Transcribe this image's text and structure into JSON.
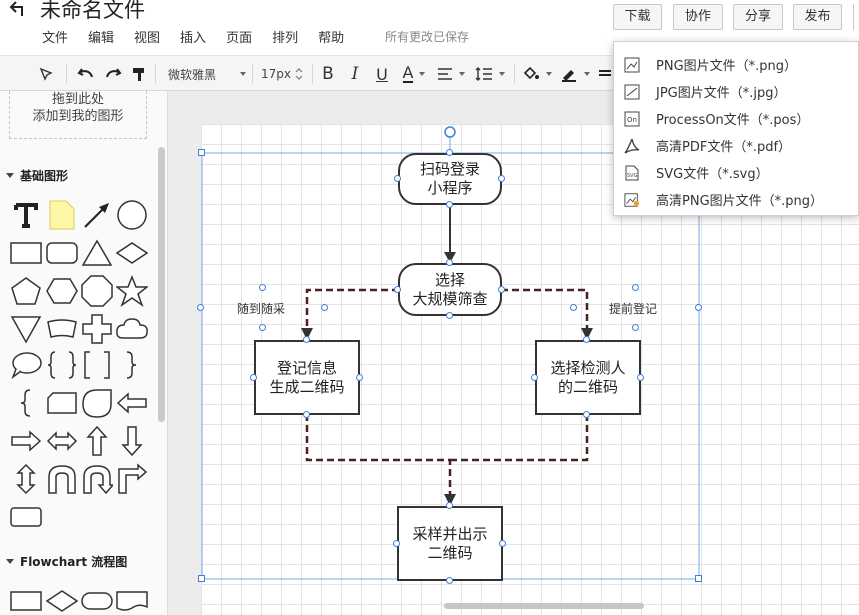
{
  "document": {
    "title": "未命名文件"
  },
  "menubar": {
    "items": [
      "文件",
      "编辑",
      "视图",
      "插入",
      "页面",
      "排列",
      "帮助"
    ],
    "save_status": "所有更改已保存"
  },
  "top_buttons": {
    "download": "下载",
    "collaborate": "协作",
    "share": "分享",
    "publish": "发布"
  },
  "toolbar": {
    "font_family": "微软雅黑",
    "font_size": "17px",
    "bold": "B",
    "italic": "I",
    "underline": "U",
    "font_color": "A"
  },
  "left_panel": {
    "drop_zone": {
      "line1": "拖到此处",
      "line2": "添加到我的图形"
    },
    "sections": [
      {
        "label": "基础图形"
      },
      {
        "label": "Flowchart 流程图"
      }
    ]
  },
  "flowchart": {
    "nodes": [
      {
        "id": "scan-login",
        "text": "扫码登录\n小程序"
      },
      {
        "id": "choose-screening",
        "text": "选择\n大规模筛查"
      },
      {
        "id": "register-info",
        "text": "登记信息\n生成二维码"
      },
      {
        "id": "choose-person",
        "text": "选择检测人\n的二维码"
      },
      {
        "id": "sample-qr",
        "text": "采样并出示\n二维码"
      }
    ],
    "labels": {
      "left": "随到随采",
      "right": "提前登记"
    }
  },
  "export_menu": {
    "items": [
      {
        "label": "PNG图片文件（*.png）",
        "icon": "png-file-icon"
      },
      {
        "label": "JPG图片文件（*.jpg）",
        "icon": "jpg-file-icon"
      },
      {
        "label": "ProcessOn文件（*.pos）",
        "icon": "pos-file-icon"
      },
      {
        "label": "高清PDF文件（*.pdf）",
        "icon": "pdf-file-icon"
      },
      {
        "label": "SVG文件（*.svg）",
        "icon": "svg-file-icon"
      },
      {
        "label": "高清PNG图片文件（*.png）",
        "icon": "hd-png-file-icon"
      }
    ]
  },
  "colors": {
    "selection": "#3c82d8",
    "node_border": "#333333",
    "edge_dashed": "#4a2020"
  }
}
